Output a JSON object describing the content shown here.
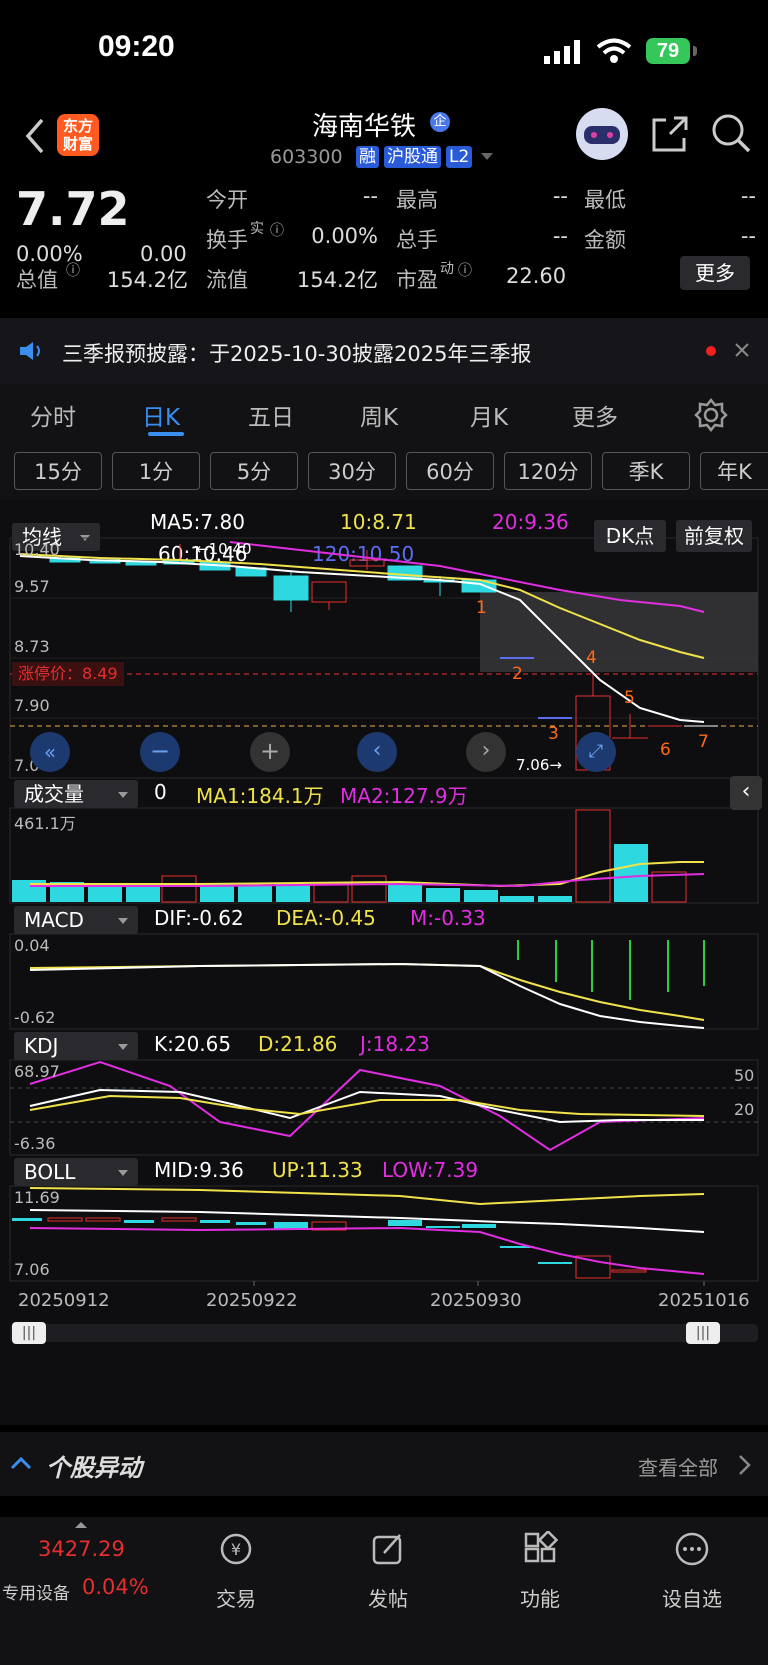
{
  "status": {
    "time": "09:20",
    "battery": "79"
  },
  "header": {
    "logo": "东方\n财富",
    "name": "海南华铁",
    "code": "603300",
    "badge_qi": "企",
    "tags": [
      "融",
      "沪股通",
      "L2"
    ]
  },
  "quote": {
    "price": "7.72",
    "change_pct": "0.00%",
    "change": "0.00",
    "open_label": "今开",
    "open": "--",
    "high_label": "最高",
    "high": "--",
    "low_label": "最低",
    "low": "--",
    "turnover_label": "换手",
    "turnover_sup": "实",
    "turnover": "0.00%",
    "volume_label": "总手",
    "volume": "--",
    "amount_label": "金额",
    "amount": "--",
    "mcap_label": "总值",
    "mcap": "154.2亿",
    "float_label": "流值",
    "float": "154.2亿",
    "pe_label": "市盈",
    "pe_sup": "动",
    "pe": "22.60",
    "more_button": "更多"
  },
  "notice": {
    "text": "三季报预披露：于2025-10-30披露2025年三季报"
  },
  "tabs": [
    "分时",
    "日K",
    "五日",
    "周K",
    "月K",
    "更多"
  ],
  "periods": [
    "15分",
    "1分",
    "5分",
    "30分",
    "60分",
    "120分",
    "季K",
    "年K"
  ],
  "ma_panel": {
    "dropdown": "均线",
    "ma5": "MA5:7.80",
    "ma10": "10:8.71",
    "ma20": "20:9.36",
    "ma60": "60:10.46",
    "ma120": "120:10.50",
    "dk_button": "DK点",
    "fq_button": "前复权",
    "y_labels": [
      "10.40",
      "9.57",
      "8.73",
      "7.90",
      "7.06"
    ],
    "limit_label": "涨停价：8.49",
    "high_marker": "←10.40",
    "low_marker": "7.06→",
    "signals": [
      "1",
      "2",
      "3",
      "4",
      "5",
      "6",
      "7"
    ]
  },
  "volume_panel": {
    "dropdown": "成交量",
    "vol": "0",
    "ma1": "MA1:184.1万",
    "ma2": "MA2:127.9万",
    "max_label": "461.1万"
  },
  "macd_panel": {
    "dropdown": "MACD",
    "dif": "DIF:-0.62",
    "dea": "DEA:-0.45",
    "m": "M:-0.33",
    "top": "0.04",
    "bottom": "-0.62"
  },
  "kdj_panel": {
    "dropdown": "KDJ",
    "k": "K:20.65",
    "d": "D:21.86",
    "j": "J:18.23",
    "top": "68.97",
    "bottom": "-6.36",
    "level_50": "50",
    "level_20": "20"
  },
  "boll_panel": {
    "dropdown": "BOLL",
    "mid": "MID:9.36",
    "up": "UP:11.33",
    "low": "LOW:7.39",
    "top": "11.69",
    "bottom": "7.06"
  },
  "dates": [
    "20250912",
    "20250922",
    "20250930",
    "20251016"
  ],
  "section": {
    "title": "个股异动",
    "link": "查看全部"
  },
  "bottom_nav": {
    "index_value": "3427.29",
    "index_label": "专用设备",
    "index_change": "0.04%",
    "items": [
      "交易",
      "发帖",
      "功能",
      "设自选"
    ]
  },
  "colors": {
    "up": "#e62e2e",
    "down": "#2ed8e0",
    "ma5": "#ffffff",
    "ma10": "#f0e24a",
    "ma20": "#e02ee0",
    "ma120": "#5b6ef0"
  }
}
